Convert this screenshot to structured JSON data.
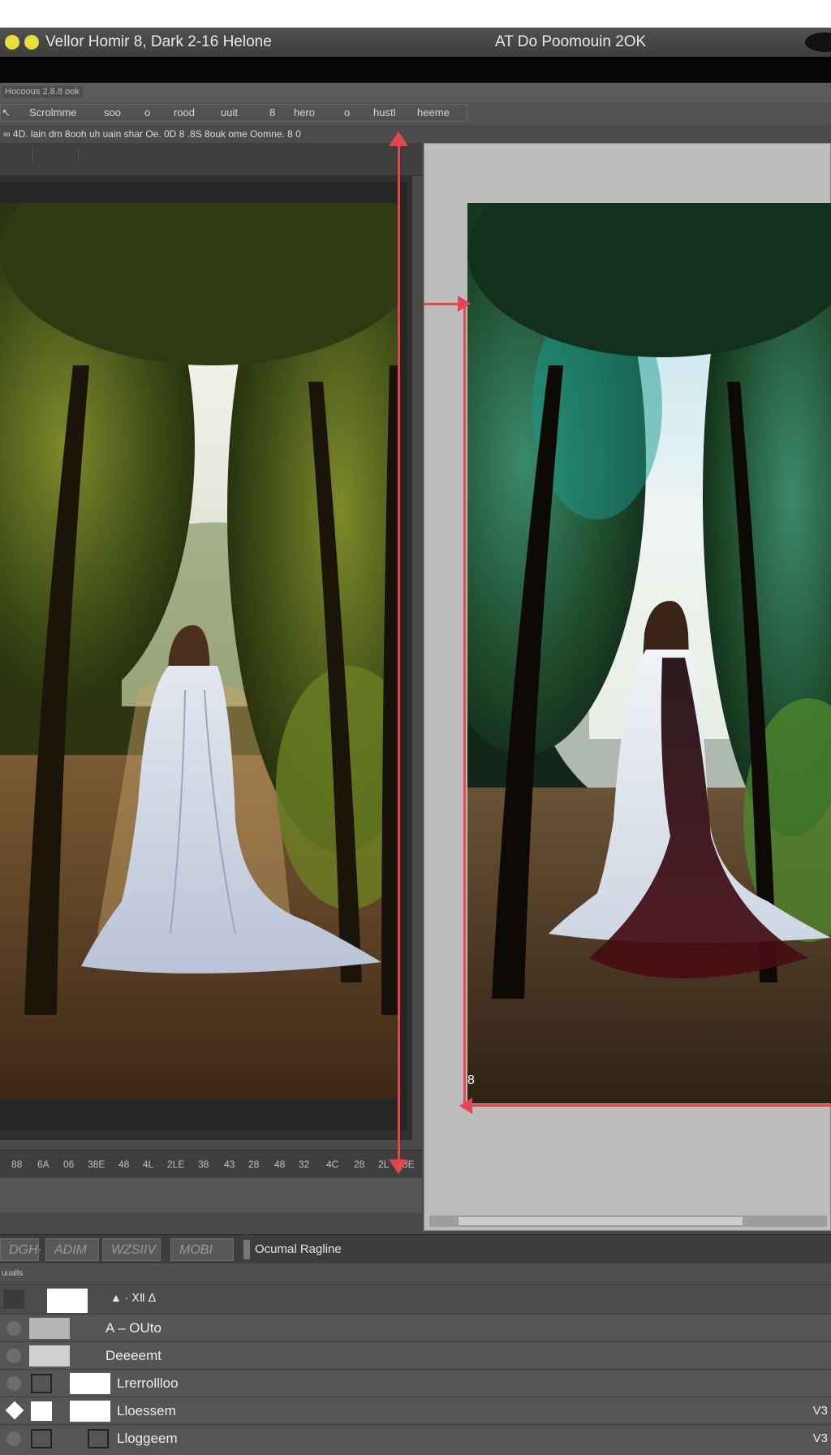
{
  "window": {
    "title_left": "Vellor Homir 8, Dark 2-16 Helone",
    "title_right": "AT Do Poomouin 2OK"
  },
  "toolbar": {
    "breadcrumb": "Hocoous 2.8.8 ook",
    "items": [
      "Scrolmme",
      "soo",
      "o",
      "rood",
      "uuit",
      "8",
      "hero",
      "o",
      "hustl",
      "heeme"
    ],
    "options_text": "∞ 4D. lain dm 8ooh uh uain shar Oe. 0D 8 .8S 8ouk ome Oomne. 8 0"
  },
  "rulers": {
    "horizontal_ticks": [
      "88",
      "6A",
      "06",
      "38E",
      "48",
      "4L",
      "2LE",
      "38",
      "43",
      "28",
      "48",
      "32",
      "4C",
      "28",
      "2L",
      "3E"
    ]
  },
  "canvas": {
    "left_photo_desc": "forest path, woman in white gown (original)",
    "right_marker": "8"
  },
  "bottom_tabs": {
    "tabs": [
      "DGH·",
      "ADIM",
      "WZSIIV",
      "MOBI"
    ],
    "active_label": "Ocumal Ragline"
  },
  "layers": {
    "header": "uualls",
    "rows": [
      {
        "name": "▲ · ⅩⅡ ᐃ",
        "suffix": ""
      },
      {
        "name": "A – OUto",
        "suffix": ""
      },
      {
        "name": "Deeeemt",
        "suffix": ""
      },
      {
        "name": "Lrerrollloo",
        "suffix": ""
      },
      {
        "name": "Lloessem",
        "suffix": "V3"
      },
      {
        "name": "Lloggeem",
        "suffix": "V3"
      }
    ]
  },
  "colors": {
    "guide_red": "#e3464e",
    "traffic_yellow": "#e6e03a"
  }
}
